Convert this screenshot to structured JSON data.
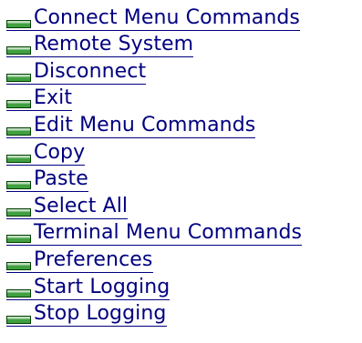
{
  "icon": "closed-book-icon",
  "colors": {
    "link": "#000080",
    "icon_top": "#c0dcc0",
    "icon_body": "#40a040",
    "icon_edge": "#004000"
  },
  "topics": [
    {
      "label": "Connect Menu Commands"
    },
    {
      "label": "Remote System"
    },
    {
      "label": "Disconnect"
    },
    {
      "label": "Exit"
    },
    {
      "label": "Edit Menu Commands"
    },
    {
      "label": "Copy"
    },
    {
      "label": "Paste"
    },
    {
      "label": "Select All"
    },
    {
      "label": "Terminal Menu Commands"
    },
    {
      "label": "Preferences"
    },
    {
      "label": "Start Logging"
    },
    {
      "label": "Stop Logging"
    }
  ]
}
